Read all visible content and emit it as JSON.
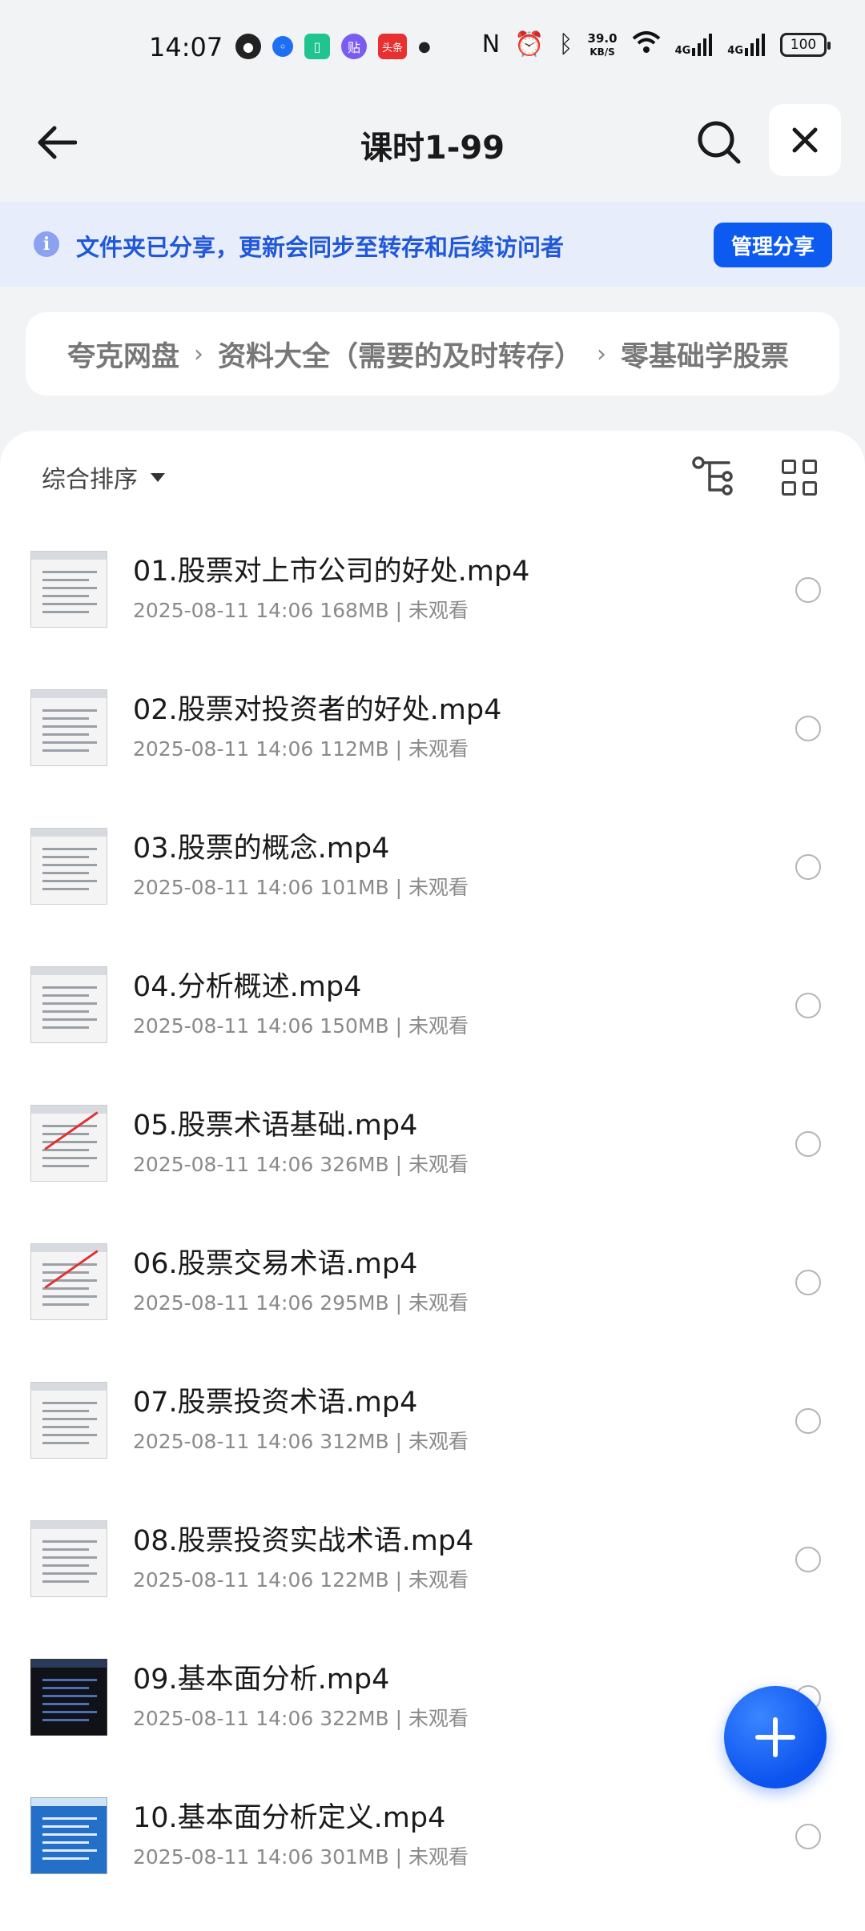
{
  "status_bar": {
    "time": "14:07",
    "notif_icons": [
      "robot-icon",
      "browser-icon",
      "phone-icon",
      "tieba-icon",
      "toutiao-icon"
    ],
    "toutiao_label": "头条",
    "tieba_label": "贴",
    "net_speed_value": "39.0",
    "net_speed_unit": "KB/S",
    "signal_label_1": "4G",
    "signal_label_2": "4G",
    "battery": "100"
  },
  "header": {
    "title": "课时1-99"
  },
  "share_banner": {
    "text": "文件夹已分享，更新会同步至转存和后续访问者",
    "button": "管理分享",
    "info_glyph": "i"
  },
  "breadcrumb": {
    "items": [
      "夸克网盘",
      "资料大全（需要的及时转存）",
      "零基础学股票"
    ],
    "separator": "›"
  },
  "toolbar": {
    "sort_label": "综合排序"
  },
  "files": [
    {
      "name": "01.股票对上市公司的好处.mp4",
      "meta": "2025-08-11 14:06  168MB | 未观看",
      "thumb": "doc"
    },
    {
      "name": "02.股票对投资者的好处.mp4",
      "meta": "2025-08-11 14:06  112MB | 未观看",
      "thumb": "doc"
    },
    {
      "name": "03.股票的概念.mp4",
      "meta": "2025-08-11 14:06  101MB | 未观看",
      "thumb": "doc"
    },
    {
      "name": "04.分析概述.mp4",
      "meta": "2025-08-11 14:06  150MB | 未观看",
      "thumb": "doc"
    },
    {
      "name": "05.股票术语基础.mp4",
      "meta": "2025-08-11 14:06  326MB | 未观看",
      "thumb": "doc-red"
    },
    {
      "name": "06.股票交易术语.mp4",
      "meta": "2025-08-11 14:06  295MB | 未观看",
      "thumb": "doc-red"
    },
    {
      "name": "07.股票投资术语.mp4",
      "meta": "2025-08-11 14:06  312MB | 未观看",
      "thumb": "doc"
    },
    {
      "name": "08.股票投资实战术语.mp4",
      "meta": "2025-08-11 14:06  122MB | 未观看",
      "thumb": "doc"
    },
    {
      "name": "09.基本面分析.mp4",
      "meta": "2025-08-11 14:06  322MB | 未观看",
      "thumb": "dark"
    },
    {
      "name": "10.基本面分析定义.mp4",
      "meta": "2025-08-11 14:06  301MB | 未观看",
      "thumb": "blue"
    }
  ],
  "colors": {
    "accent": "#0d5af0",
    "banner_bg": "#e8edfb",
    "banner_text": "#2058d8"
  }
}
